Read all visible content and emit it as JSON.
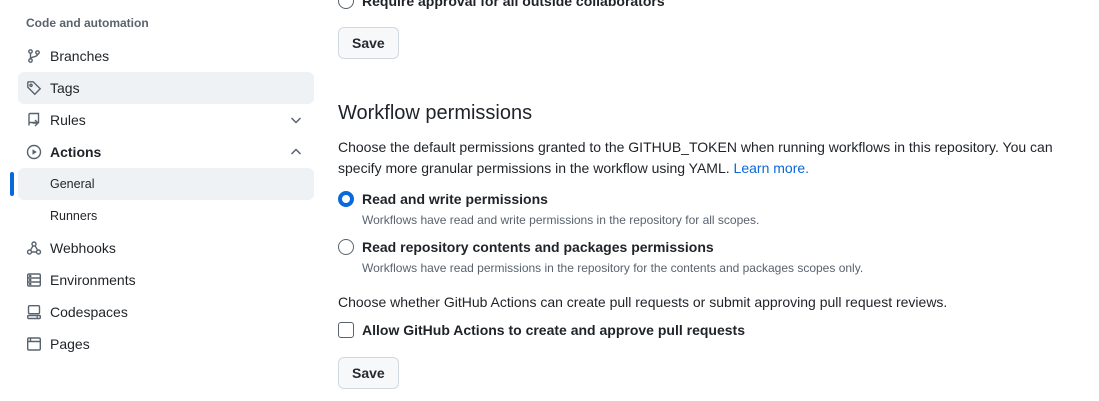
{
  "sidebar": {
    "heading": "Code and automation",
    "items": [
      {
        "label": "Branches",
        "icon": "git-branch-icon"
      },
      {
        "label": "Tags",
        "icon": "tag-icon"
      },
      {
        "label": "Rules",
        "icon": "repo-push-icon"
      },
      {
        "label": "Actions",
        "icon": "play-icon"
      },
      {
        "label": "General"
      },
      {
        "label": "Runners"
      },
      {
        "label": "Webhooks",
        "icon": "webhook-icon"
      },
      {
        "label": "Environments",
        "icon": "server-icon"
      },
      {
        "label": "Codespaces",
        "icon": "codespaces-icon"
      },
      {
        "label": "Pages",
        "icon": "browser-icon"
      }
    ]
  },
  "main": {
    "outside_collaborators_label": "Require approval for all outside collaborators",
    "save_top_label": "Save",
    "workflow": {
      "title": "Workflow permissions",
      "description": "Choose the default permissions granted to the GITHUB_TOKEN when running workflows in this repository. You can specify more granular permissions in the workflow using YAML.",
      "learn_more": "Learn more.",
      "options": [
        {
          "label": "Read and write permissions",
          "note": "Workflows have read and write permissions in the repository for all scopes.",
          "checked": true
        },
        {
          "label": "Read repository contents and packages permissions",
          "note": "Workflows have read permissions in the repository for the contents and packages scopes only.",
          "checked": false
        }
      ],
      "pr_question": "Choose whether GitHub Actions can create pull requests or submit approving pull request reviews.",
      "pr_checkbox_label": "Allow GitHub Actions to create and approve pull requests",
      "pr_checkbox_checked": false,
      "save_label": "Save"
    }
  },
  "colors": {
    "accent": "#0969da",
    "muted": "#59636e",
    "nav_active_bg": "#eff2f5"
  }
}
